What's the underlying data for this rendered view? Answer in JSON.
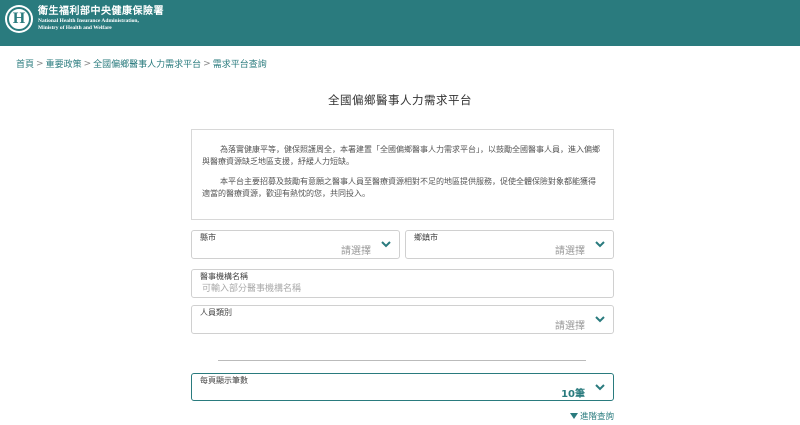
{
  "header": {
    "org_zh": "衛生福利部中央健康保險署",
    "org_en_line1": "National Health Insurance Administration,",
    "org_en_line2": "Ministry of Health and Welfare",
    "logo_letter": "H",
    "bg_color": "#2a7b7e"
  },
  "breadcrumb": {
    "separator": ">",
    "items": [
      "首頁",
      "重要政策",
      "全國偏鄉醫事人力需求平台",
      "需求平台查詢"
    ]
  },
  "main": {
    "title": "全國偏鄉醫事人力需求平台",
    "intro": [
      "為落實健康平等，健保照護周全，本署建置「全國偏鄉醫事人力需求平台」，以鼓勵全國醫事人員，進入偏鄉與醫療資源缺乏地區支援，紓緩人力短缺。",
      "本平台主要招募及鼓勵有意願之醫事人員至醫療資源相對不足的地區提供服務，促使全體保險對象都能獲得適當的醫療資源，歡迎有熱忱的您，共同投入。"
    ]
  },
  "form": {
    "county": {
      "label": "縣市",
      "value": "請選擇"
    },
    "township": {
      "label": "鄉鎮市",
      "value": "請選擇"
    },
    "institution": {
      "label": "醫事機構名稱",
      "placeholder": "可輸入部分醫事機構名稱"
    },
    "staff_type": {
      "label": "人員類別",
      "value": "請選擇"
    },
    "per_page": {
      "label": "每頁顯示筆數",
      "value": "10筆"
    },
    "advanced_search": "進階查詢"
  }
}
